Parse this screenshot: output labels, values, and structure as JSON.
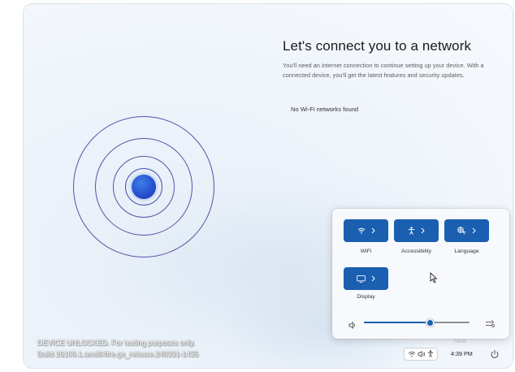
{
  "page": {
    "title": "Let's connect you to a network",
    "description": "You'll need an internet connection to continue setting up your device. With a connected device, you'll get the latest features and security updates.",
    "no_networks": "No Wi-Fi networks found",
    "next_label": "Next"
  },
  "quick_settings": {
    "tiles": [
      {
        "label": "WiFi",
        "icon": "wifi-icon"
      },
      {
        "label": "Accessibility",
        "icon": "accessibility-icon"
      },
      {
        "label": "Language",
        "icon": "language-icon"
      },
      {
        "label": "Display",
        "icon": "display-icon"
      }
    ],
    "volume_level": 0.63
  },
  "watermark": {
    "line1": "DEVICE UNLOCKED. For testing purposes only.",
    "line2": "Build 26100.1.amd64fre.ge_release.240331-1435"
  },
  "taskbar": {
    "time": "4:39 PM",
    "tray_icons": [
      "wifi-icon",
      "speaker-icon",
      "accessibility-icon"
    ],
    "power_icon": "power-icon"
  },
  "colors": {
    "accent": "#1a5fb0",
    "rings": "#5b4fa8",
    "dot": "#2146c8"
  }
}
